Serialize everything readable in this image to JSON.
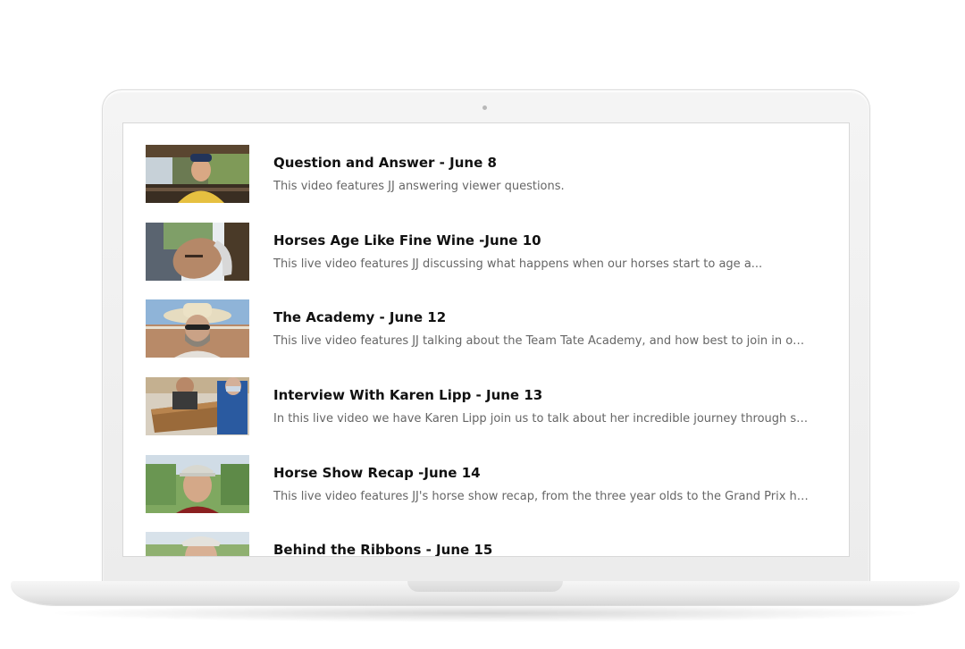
{
  "videos": [
    {
      "title": "Question and Answer - June 8",
      "description": "This video features JJ answering viewer questions.",
      "thumbnail": "woman-with-cap-on-porch"
    },
    {
      "title": "Horses Age Like Fine Wine -June 10",
      "description": "This live video features JJ discussing what happens when our horses start to age a...",
      "thumbnail": "tilted-selfie-outdoors"
    },
    {
      "title": "The Academy - June 12",
      "description": "This live video features JJ talking about the Team Tate Academy, and how best to join in on the e...",
      "thumbnail": "person-in-hat-and-mask"
    },
    {
      "title": "Interview With Karen Lipp - June 13",
      "description": "In this live video we have Karen Lipp join us to talk about her incredible journey through surger...",
      "thumbnail": "two-people-at-picnic-table"
    },
    {
      "title": "Horse Show Recap -June 14",
      "description": "This live video features JJ's horse show recap, from the three year olds to the Grand Prix horses...",
      "thumbnail": "woman-with-visor-in-garden"
    },
    {
      "title": "Behind the Ribbons - June 15",
      "description": "",
      "thumbnail": "woman-with-visor-outdoors"
    }
  ]
}
